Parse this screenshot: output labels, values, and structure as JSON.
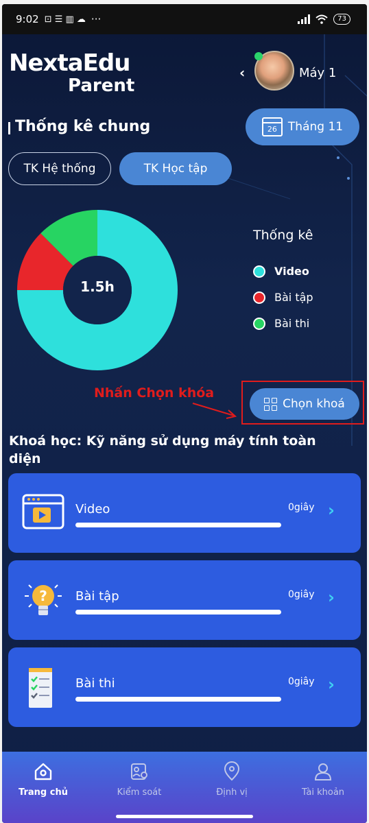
{
  "status_bar": {
    "time": "9:02",
    "extra": "···",
    "battery": "73"
  },
  "header": {
    "logo_main": "NextaEdu",
    "logo_sub": "Parent",
    "device_name": "Máy 1"
  },
  "stats": {
    "section_title": "Thống kê chung",
    "month_day": "26",
    "month_label": "Tháng 11",
    "tabs": [
      {
        "label": "TK Hệ thống",
        "active": false
      },
      {
        "label": "TK Học tập",
        "active": true
      }
    ]
  },
  "chart_data": {
    "type": "pie",
    "center_label": "1.5h",
    "legend_title": "Thống kê",
    "categories": [
      "Video",
      "Bài tập",
      "Bài thi"
    ],
    "values": [
      0.75,
      0.125,
      0.125
    ],
    "colors": [
      "#2ee0dc",
      "#e8262b",
      "#27d462"
    ],
    "start_angle_deg": 0
  },
  "annotation": {
    "text": "Nhấn Chọn khóa",
    "color": "#e01c1c"
  },
  "choose_button": {
    "label": "Chọn khoá"
  },
  "course": {
    "title": "Khoá học: Kỹ năng sử dụng máy tính toàn diện",
    "items": [
      {
        "label": "Video",
        "time": "0giây",
        "icon": "video-player-icon"
      },
      {
        "label": "Bài tập",
        "time": "0giây",
        "icon": "lightbulb-icon"
      },
      {
        "label": "Bài thi",
        "time": "0giây",
        "icon": "checklist-icon"
      }
    ]
  },
  "bottom_nav": [
    {
      "label": "Trang chủ",
      "icon": "home-icon",
      "active": true
    },
    {
      "label": "Kiểm soát",
      "icon": "control-icon",
      "active": false
    },
    {
      "label": "Định vị",
      "icon": "location-icon",
      "active": false
    },
    {
      "label": "Tài khoản",
      "icon": "account-icon",
      "active": false
    }
  ],
  "colors": {
    "accent": "#4a86d4",
    "card": "#2d5ce0",
    "chevron": "#3fd0f2"
  }
}
